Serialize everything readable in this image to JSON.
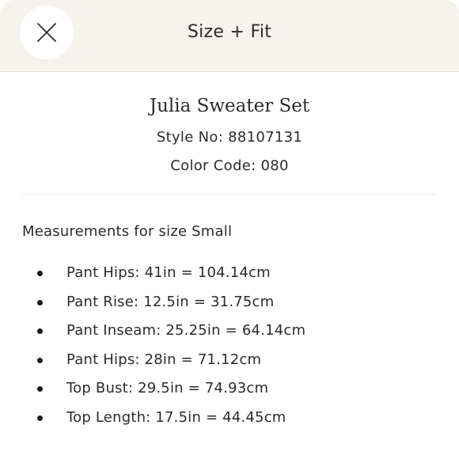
{
  "header": {
    "title": "Size + Fit",
    "close_icon": "close-icon"
  },
  "product": {
    "name": "Julia Sweater Set",
    "style_no": "Style No: 88107131",
    "color_code": "Color Code: 080"
  },
  "measurements": {
    "heading": "Measurements for size Small",
    "items": [
      "Pant Hips: 41in = 104.14cm",
      "Pant Rise: 12.5in = 31.75cm",
      "Pant Inseam: 25.25in = 64.14cm",
      "Pant Hips: 28in = 71.12cm",
      "Top Bust: 29.5in = 74.93cm",
      "Top Length: 17.5in = 44.45cm"
    ]
  }
}
